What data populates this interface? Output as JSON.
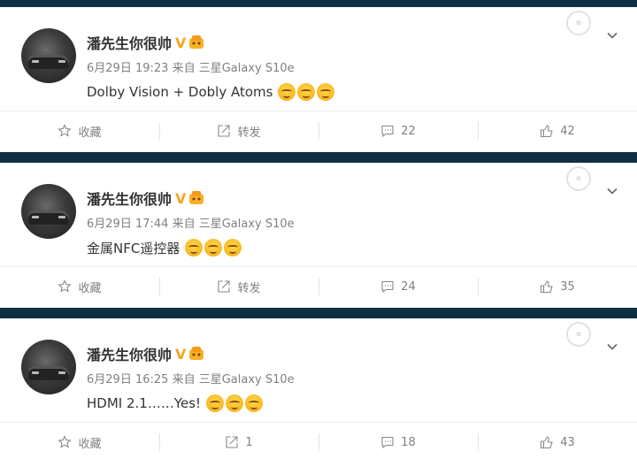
{
  "posts": [
    {
      "author": "潘先生你很帅",
      "verified_badge": "V",
      "date": "6月29日 19:23",
      "source_prefix": "来自",
      "source": "三星Galaxy S10e",
      "content": "Dolby Vision  +  Dobly Atoms",
      "emoji_count": 3,
      "actions": {
        "favorite": "收藏",
        "repost": "转发",
        "comments": "22",
        "likes": "42"
      }
    },
    {
      "author": "潘先生你很帅",
      "verified_badge": "V",
      "date": "6月29日 17:44",
      "source_prefix": "来自",
      "source": "三星Galaxy S10e",
      "content": "金属NFC遥控器",
      "emoji_count": 3,
      "actions": {
        "favorite": "收藏",
        "repost": "转发",
        "comments": "24",
        "likes": "35"
      }
    },
    {
      "author": "潘先生你很帅",
      "verified_badge": "V",
      "date": "6月29日 16:25",
      "source_prefix": "来自",
      "source": "三星Galaxy S10e",
      "content": "HDMI 2.1……Yes!",
      "emoji_count": 3,
      "actions": {
        "favorite": "收藏",
        "repost": "1",
        "comments": "18",
        "likes": "43"
      }
    }
  ],
  "icons": [
    "star-icon",
    "share-icon",
    "comment-icon",
    "thumbs-up-icon",
    "chevron-down-icon",
    "smile-emoji-icon"
  ],
  "colors": {
    "accent_badge": "#f5a623",
    "text_primary": "#333333",
    "text_secondary": "#808080",
    "background": "#0f2e44"
  }
}
